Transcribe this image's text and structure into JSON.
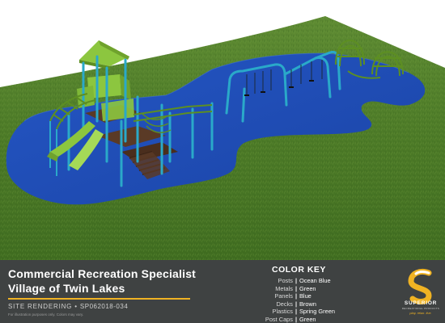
{
  "title": {
    "line1": "Commercial Recreation Specialist",
    "line2": "Village of Twin Lakes"
  },
  "site": {
    "label": "SITE RENDERING",
    "separator": "•",
    "number": "SP062018-034",
    "disclaimer": "For illustration purposes only. Colors may vary."
  },
  "color_key": {
    "heading": "COLOR KEY",
    "items": [
      {
        "name": "Posts",
        "value": "Ocean Blue"
      },
      {
        "name": "Metals",
        "value": "Green"
      },
      {
        "name": "Panels",
        "value": "Blue"
      },
      {
        "name": "Decks",
        "value": "Brown"
      },
      {
        "name": "Plastics",
        "value": "Spring Green"
      },
      {
        "name": "Post Caps",
        "value": "Green"
      }
    ]
  },
  "brand": {
    "name": "SUPERIOR",
    "subtitle": "RECREATIONAL PRODUCTS",
    "tagline": "play. relax. live."
  },
  "colors": {
    "grass": "#4f7d2a",
    "surface": "#1f4fb4",
    "post": "#2aa9c9",
    "plastic": "#8cc63f",
    "deck": "#5a3a26",
    "titlebar": "#3f4242",
    "accent": "#f0b323"
  }
}
